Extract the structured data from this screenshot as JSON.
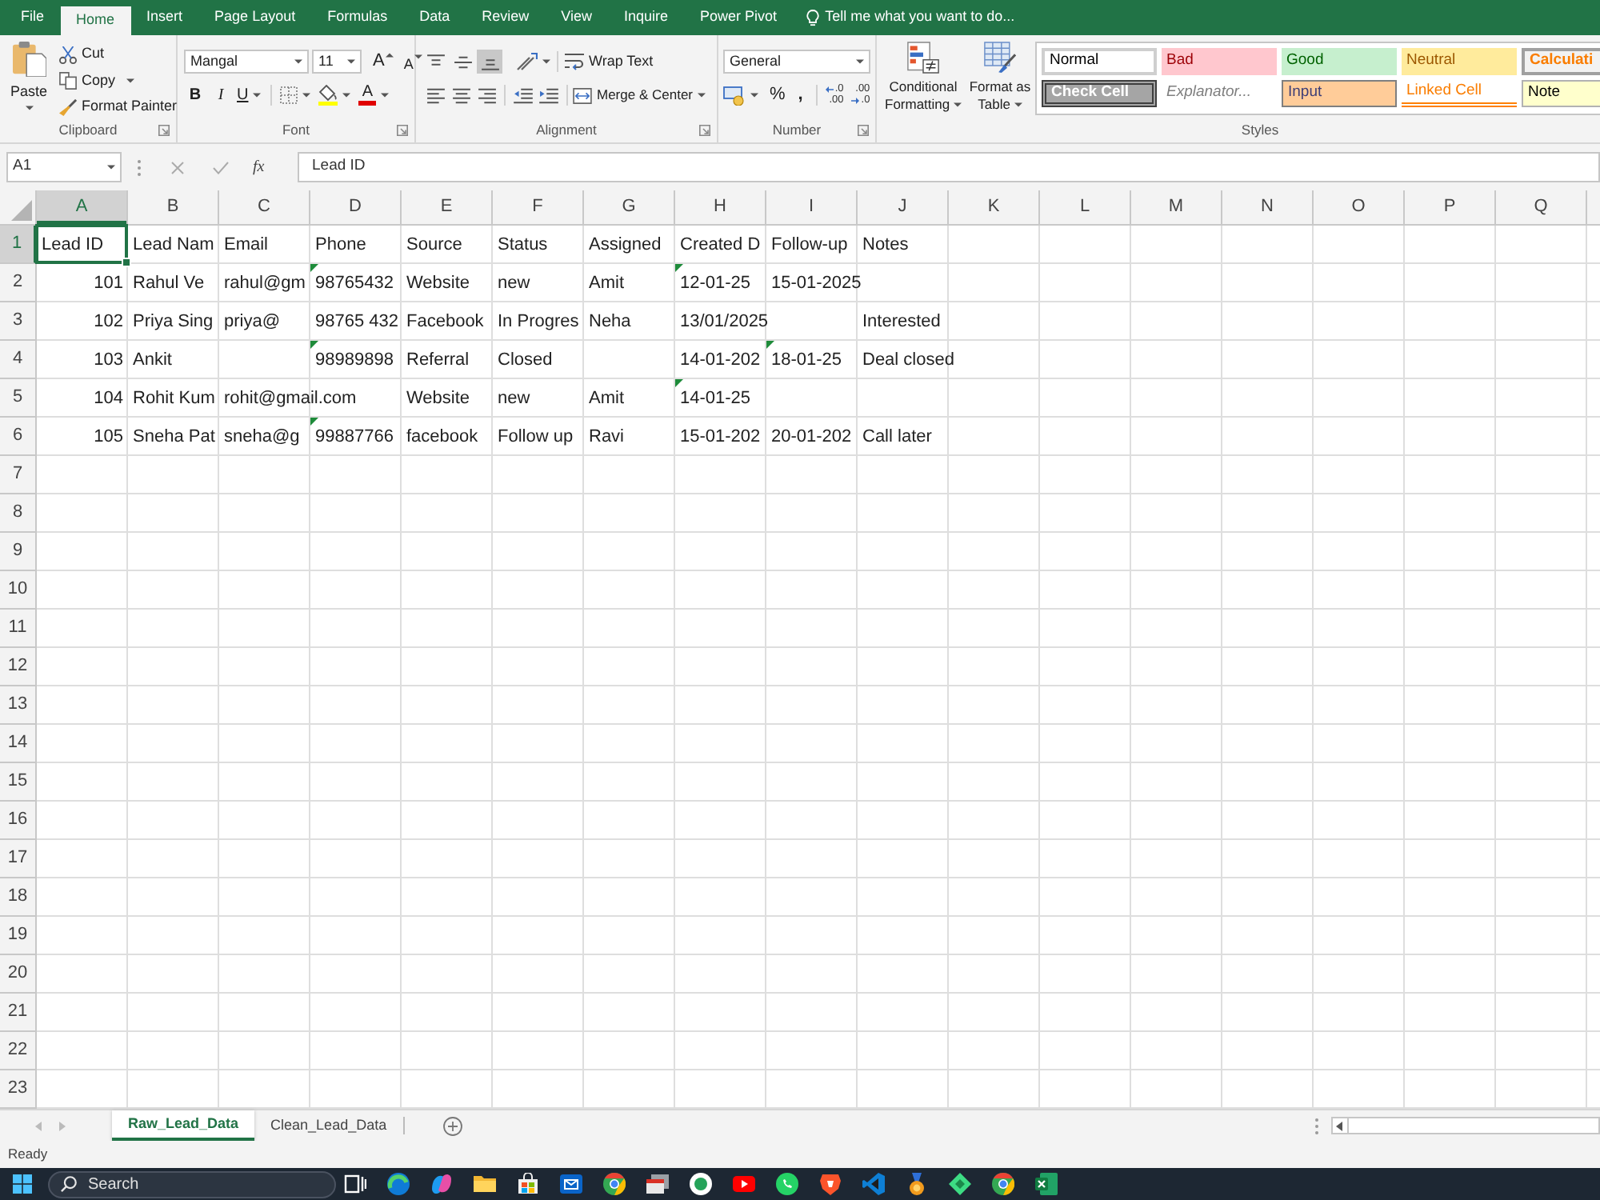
{
  "menu_tabs": [
    {
      "label": "File",
      "selected": false
    },
    {
      "label": "Home",
      "selected": true
    },
    {
      "label": "Insert",
      "selected": false
    },
    {
      "label": "Page Layout",
      "selected": false
    },
    {
      "label": "Formulas",
      "selected": false
    },
    {
      "label": "Data",
      "selected": false
    },
    {
      "label": "Review",
      "selected": false
    },
    {
      "label": "View",
      "selected": false
    },
    {
      "label": "Inquire",
      "selected": false
    },
    {
      "label": "Power Pivot",
      "selected": false
    }
  ],
  "tell_me": {
    "placeholder": "Tell me what you want to do..."
  },
  "ribbon": {
    "clipboard": {
      "paste": "Paste",
      "cut": "Cut",
      "copy": "Copy",
      "format_painter": "Format Painter",
      "label": "Clipboard"
    },
    "font": {
      "font_name": "Mangal",
      "font_size": "11",
      "grow_font": "A",
      "shrink_font": "A",
      "bold": "B",
      "italic": "I",
      "underline": "U",
      "font_color": "A",
      "label": "Font"
    },
    "alignment": {
      "vertical": [
        {
          "kind": "top",
          "selected": false
        },
        {
          "kind": "middle",
          "selected": false
        },
        {
          "kind": "bottom",
          "selected": true
        }
      ],
      "horizontal": [
        {
          "kind": "left",
          "selected": false
        },
        {
          "kind": "center",
          "selected": false
        },
        {
          "kind": "right",
          "selected": false
        }
      ],
      "wrap_text": "Wrap Text",
      "merge": "Merge & Center",
      "label": "Alignment"
    },
    "number": {
      "format": "General",
      "percent": "%",
      "comma": ",",
      "increase_decimal": {
        "top": ".0",
        "bottom": ".00"
      },
      "decrease_decimal": {
        "top": ".00",
        "bottom": ".0"
      },
      "label": "Number"
    },
    "styles": {
      "conditional_formatting": "Conditional Formatting",
      "format_as_table": "Format as Table",
      "gallery": [
        {
          "label": "Normal",
          "kind": "normal"
        },
        {
          "label": "Bad",
          "kind": "bad"
        },
        {
          "label": "Good",
          "kind": "good"
        },
        {
          "label": "Neutral",
          "kind": "neutral"
        },
        {
          "label": "Calculati",
          "kind": "calculation"
        },
        {
          "label": "Check Cell",
          "kind": "check"
        },
        {
          "label": "Explanator...",
          "kind": "explanatory"
        },
        {
          "label": "Input",
          "kind": "input"
        },
        {
          "label": "Linked Cell",
          "kind": "linked"
        },
        {
          "label": "Note",
          "kind": "note"
        }
      ],
      "label": "Styles"
    }
  },
  "formula_bar": {
    "name_box": "A1",
    "function_button": "fx",
    "formula": "Lead ID"
  },
  "sheet": {
    "columns": [
      {
        "label": "A",
        "selected": true
      },
      {
        "label": "B",
        "selected": false
      },
      {
        "label": "C",
        "selected": false
      },
      {
        "label": "D",
        "selected": false
      },
      {
        "label": "E",
        "selected": false
      },
      {
        "label": "F",
        "selected": false
      },
      {
        "label": "G",
        "selected": false
      },
      {
        "label": "H",
        "selected": false
      },
      {
        "label": "I",
        "selected": false
      },
      {
        "label": "J",
        "selected": false
      },
      {
        "label": "K",
        "selected": false
      },
      {
        "label": "L",
        "selected": false
      },
      {
        "label": "M",
        "selected": false
      },
      {
        "label": "N",
        "selected": false
      },
      {
        "label": "O",
        "selected": false
      },
      {
        "label": "P",
        "selected": false
      },
      {
        "label": "Q",
        "selected": false
      }
    ],
    "rows": [
      {
        "label": "1",
        "selected": true,
        "cells": [
          {
            "text": "Lead ID",
            "kind": "text",
            "warning": false
          },
          {
            "text": "Lead Nam",
            "kind": "text",
            "warning": false
          },
          {
            "text": "Email",
            "kind": "text",
            "warning": false
          },
          {
            "text": "Phone",
            "kind": "text",
            "warning": false
          },
          {
            "text": "Source",
            "kind": "text",
            "warning": false
          },
          {
            "text": "Status",
            "kind": "text",
            "warning": false
          },
          {
            "text": "Assigned",
            "kind": "text",
            "warning": false
          },
          {
            "text": "Created D",
            "kind": "text",
            "warning": false
          },
          {
            "text": "Follow-up",
            "kind": "text",
            "warning": false
          },
          {
            "text": "Notes",
            "kind": "text",
            "warning": false
          }
        ]
      },
      {
        "label": "2",
        "selected": false,
        "cells": [
          {
            "text": "101",
            "kind": "number",
            "warning": false
          },
          {
            "text": "Rahul Ve",
            "kind": "text",
            "warning": false
          },
          {
            "text": "rahul@gm",
            "kind": "text",
            "warning": false
          },
          {
            "text": "98765432",
            "kind": "text",
            "warning": true
          },
          {
            "text": "Website",
            "kind": "text",
            "warning": false
          },
          {
            "text": "new",
            "kind": "text",
            "warning": false
          },
          {
            "text": "Amit",
            "kind": "text",
            "warning": false
          },
          {
            "text": "12-01-25",
            "kind": "text",
            "warning": true
          },
          {
            "text": "15-01-2025",
            "kind": "text",
            "warning": false
          },
          null
        ]
      },
      {
        "label": "3",
        "selected": false,
        "cells": [
          {
            "text": "102",
            "kind": "number",
            "warning": false
          },
          {
            "text": "Priya Sing",
            "kind": "text",
            "warning": false
          },
          {
            "text": "priya@",
            "kind": "text",
            "warning": false
          },
          {
            "text": "98765 432",
            "kind": "text",
            "warning": false
          },
          {
            "text": "Facebook",
            "kind": "text",
            "warning": false
          },
          {
            "text": "In Progres",
            "kind": "text",
            "warning": false
          },
          {
            "text": "Neha",
            "kind": "text",
            "warning": false
          },
          {
            "text": "13/01/2025",
            "kind": "text",
            "warning": false
          },
          null,
          {
            "text": "Interested",
            "kind": "text",
            "warning": false
          }
        ]
      },
      {
        "label": "4",
        "selected": false,
        "cells": [
          {
            "text": "103",
            "kind": "number",
            "warning": false
          },
          {
            "text": "Ankit",
            "kind": "text",
            "warning": false
          },
          null,
          {
            "text": "98989898",
            "kind": "text",
            "warning": true
          },
          {
            "text": "Referral",
            "kind": "text",
            "warning": false
          },
          {
            "text": "Closed",
            "kind": "text",
            "warning": false
          },
          null,
          {
            "text": "14-01-202",
            "kind": "text",
            "warning": false
          },
          {
            "text": "18-01-25",
            "kind": "text",
            "warning": true
          },
          {
            "text": "Deal closed",
            "kind": "text",
            "warning": false
          }
        ]
      },
      {
        "label": "5",
        "selected": false,
        "cells": [
          {
            "text": "104",
            "kind": "number",
            "warning": false
          },
          {
            "text": "Rohit Kum",
            "kind": "text",
            "warning": false
          },
          {
            "text": "rohit@gmail.com",
            "kind": "text",
            "warning": false
          },
          null,
          {
            "text": "Website",
            "kind": "text",
            "warning": false
          },
          {
            "text": "new",
            "kind": "text",
            "warning": false
          },
          {
            "text": "Amit",
            "kind": "text",
            "warning": false
          },
          {
            "text": "14-01-25",
            "kind": "text",
            "warning": true
          },
          null,
          null
        ]
      },
      {
        "label": "6",
        "selected": false,
        "cells": [
          {
            "text": "105",
            "kind": "number",
            "warning": false
          },
          {
            "text": "Sneha Pat",
            "kind": "text",
            "warning": false
          },
          {
            "text": "sneha@g",
            "kind": "text",
            "warning": false
          },
          {
            "text": "99887766",
            "kind": "text",
            "warning": true
          },
          {
            "text": "facebook",
            "kind": "text",
            "warning": false
          },
          {
            "text": "Follow up",
            "kind": "text",
            "warning": false
          },
          {
            "text": "Ravi",
            "kind": "text",
            "warning": false
          },
          {
            "text": "15-01-202",
            "kind": "text",
            "warning": false
          },
          {
            "text": "20-01-202",
            "kind": "text",
            "warning": false
          },
          {
            "text": "Call later",
            "kind": "text",
            "warning": false
          }
        ]
      },
      {
        "label": "7",
        "selected": false
      },
      {
        "label": "8",
        "selected": false
      },
      {
        "label": "9",
        "selected": false
      },
      {
        "label": "10",
        "selected": false
      },
      {
        "label": "11",
        "selected": false
      },
      {
        "label": "12",
        "selected": false
      },
      {
        "label": "13",
        "selected": false
      },
      {
        "label": "14",
        "selected": false
      },
      {
        "label": "15",
        "selected": false
      },
      {
        "label": "16",
        "selected": false
      },
      {
        "label": "17",
        "selected": false
      },
      {
        "label": "18",
        "selected": false
      },
      {
        "label": "19",
        "selected": false
      },
      {
        "label": "20",
        "selected": false
      },
      {
        "label": "21",
        "selected": false
      },
      {
        "label": "22",
        "selected": false
      },
      {
        "label": "23",
        "selected": false
      }
    ]
  },
  "sheet_tabs": [
    {
      "label": "Raw_Lead_Data",
      "selected": true
    },
    {
      "label": "Clean_Lead_Data",
      "selected": false
    }
  ],
  "status_bar": {
    "text": "Ready"
  },
  "taskbar": {
    "search": {
      "placeholder": "Search"
    }
  }
}
